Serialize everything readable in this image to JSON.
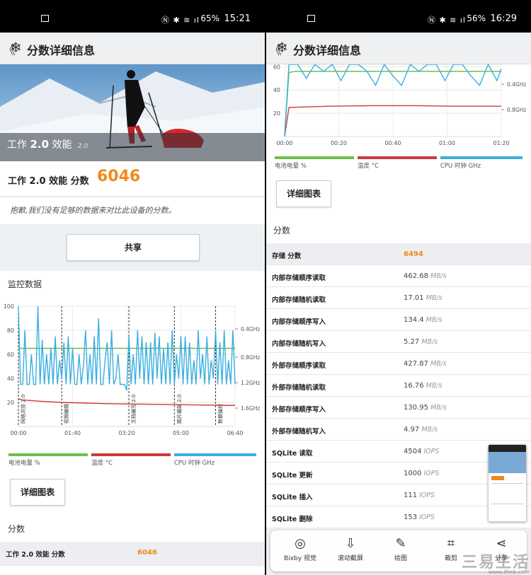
{
  "left": {
    "status": {
      "battery": "65%",
      "time": "15:21"
    },
    "appbar": {
      "back": "《",
      "title": "分数详细信息"
    },
    "hero": {
      "label_prefix": "工作",
      "label_version": "2.0",
      "label_suffix": "效能",
      "label_small": "2.0"
    },
    "score": {
      "label": "工作 2.0 效能 分数",
      "value": "6046"
    },
    "sorry_text": "抱歉,我们没有足够的数据来对比此设备的分数。",
    "share_button": "共享",
    "monitor_title": "监控数据",
    "legend": {
      "battery": "电池电量 %",
      "temp": "温度 °C",
      "cpu": "CPU 时钟 GHz"
    },
    "detail_button": "详细图表",
    "scores_title": "分数",
    "score_row": {
      "name": "工作 2.0 效能 分数",
      "value": "6046"
    },
    "chart_data": {
      "type": "line",
      "x_ticks": [
        "00:00",
        "01:40",
        "03:20",
        "05:00",
        "06:40"
      ],
      "y_ticks": [
        20,
        40,
        60,
        80,
        100
      ],
      "y2_ticks": [
        "0.4GHz",
        "0.8GHz",
        "1.2GHz",
        "1.6GHz"
      ],
      "ylim": [
        0,
        100
      ],
      "annotations": [
        "网络浏览 2.0",
        "视频编辑",
        "文档编写 2.0",
        "图片编辑 2.0",
        "数据操控"
      ],
      "series": [
        {
          "name": "电池电量 %",
          "color": "#6cc04a",
          "x": [
            0,
            0.1,
            0.2,
            0.4,
            0.6,
            0.8,
            1.0
          ],
          "y": [
            65,
            65,
            65,
            65,
            65,
            65,
            65
          ]
        },
        {
          "name": "温度 °C",
          "color": "#cc3b3b",
          "x": [
            0,
            0.02,
            0.1,
            0.2,
            0.4,
            0.6,
            0.8,
            1.0
          ],
          "y": [
            23,
            22,
            21,
            20,
            19,
            18.5,
            18,
            17.5
          ]
        },
        {
          "name": "CPU 时钟 GHz",
          "color": "#3aaee0",
          "x": [
            0,
            0.01,
            0.02,
            0.03,
            0.04,
            0.05,
            0.06,
            0.07,
            0.08,
            0.09,
            0.1,
            0.11,
            0.12,
            0.13,
            0.14,
            0.15,
            0.16,
            0.17,
            0.18,
            0.19,
            0.2,
            0.21,
            0.22,
            0.23,
            0.24,
            0.25,
            0.26,
            0.27,
            0.28,
            0.29,
            0.3,
            0.31,
            0.32,
            0.33,
            0.34,
            0.35,
            0.36,
            0.37,
            0.38,
            0.39,
            0.4,
            0.41,
            0.42,
            0.43,
            0.44,
            0.45,
            0.46,
            0.47,
            0.48,
            0.49,
            0.5,
            0.51,
            0.52,
            0.53,
            0.54,
            0.55,
            0.56,
            0.57,
            0.58,
            0.59,
            0.6,
            0.61,
            0.62,
            0.63,
            0.64,
            0.65,
            0.66,
            0.67,
            0.68,
            0.69,
            0.7,
            0.71,
            0.72,
            0.73,
            0.74,
            0.75,
            0.76,
            0.77,
            0.78,
            0.79,
            0.8,
            0.81,
            0.82,
            0.83,
            0.84,
            0.85,
            0.86,
            0.87,
            0.88,
            0.89,
            0.9,
            0.91,
            0.92,
            0.93,
            0.94,
            0.95,
            0.96,
            0.97,
            0.98,
            0.99,
            1.0
          ],
          "y": [
            100,
            35,
            35,
            80,
            35,
            35,
            60,
            35,
            35,
            100,
            35,
            72,
            35,
            60,
            35,
            65,
            35,
            75,
            35,
            55,
            40,
            70,
            35,
            75,
            35,
            65,
            35,
            35,
            60,
            35,
            50,
            80,
            35,
            60,
            35,
            75,
            35,
            90,
            35,
            35,
            55,
            70,
            35,
            80,
            35,
            40,
            60,
            35,
            35,
            35,
            30,
            75,
            35,
            60,
            35,
            80,
            40,
            75,
            35,
            70,
            35,
            70,
            35,
            78,
            40,
            75,
            35,
            65,
            35,
            70,
            35,
            80,
            35,
            60,
            40,
            75,
            35,
            75,
            35,
            70,
            35,
            55,
            35,
            80,
            40,
            60,
            35,
            75,
            35,
            55,
            40,
            80,
            35,
            70,
            35,
            80,
            35,
            55,
            35,
            80,
            35
          ]
        }
      ]
    }
  },
  "right": {
    "status": {
      "battery": "56%",
      "time": "16:29"
    },
    "appbar": {
      "back": "《",
      "title": "分数详细信息"
    },
    "legend": {
      "battery": "电池电量 %",
      "temp": "温度 °C",
      "cpu": "CPU 时钟 GHz"
    },
    "detail_button": "详细图表",
    "scores_title": "分数",
    "chart_data": {
      "type": "line",
      "x_ticks": [
        "00:00",
        "00:20",
        "00:40",
        "01:00",
        "01:20"
      ],
      "y_ticks": [
        20,
        40,
        60
      ],
      "y2_ticks": [
        "0.4GHz",
        "0.8GHz"
      ],
      "ylim": [
        0,
        62
      ],
      "series": [
        {
          "name": "电池电量 %",
          "color": "#6cc04a",
          "x": [
            0,
            0.02,
            0.05,
            1.0
          ],
          "y": [
            0,
            55,
            56,
            56
          ]
        },
        {
          "name": "温度 °C",
          "color": "#cc3b3b",
          "x": [
            0,
            0.02,
            0.2,
            0.4,
            0.6,
            0.8,
            1.0
          ],
          "y": [
            0,
            25,
            26,
            26.5,
            26.5,
            26,
            26
          ]
        },
        {
          "name": "CPU 时钟 GHz",
          "color": "#3aaee0",
          "x": [
            0,
            0.02,
            0.06,
            0.1,
            0.14,
            0.18,
            0.22,
            0.26,
            0.3,
            0.34,
            0.38,
            0.42,
            0.46,
            0.5,
            0.54,
            0.58,
            0.62,
            0.66,
            0.7,
            0.74,
            0.78,
            0.82,
            0.86,
            0.9,
            0.94,
            0.98,
            1.0
          ],
          "y": [
            0,
            62,
            62,
            50,
            62,
            56,
            62,
            48,
            62,
            62,
            56,
            44,
            62,
            52,
            44,
            62,
            56,
            62,
            62,
            48,
            62,
            62,
            52,
            44,
            62,
            48,
            58
          ]
        }
      ]
    },
    "rows": [
      {
        "name": "存储 分数",
        "value": "6494",
        "unit": "",
        "highlight": true
      },
      {
        "name": "内部存储顺序读取",
        "value": "462.68",
        "unit": "MB/s"
      },
      {
        "name": "内部存储随机读取",
        "value": "17.01",
        "unit": "MB/s"
      },
      {
        "name": "内部存储顺序写入",
        "value": "134.4",
        "unit": "MB/s"
      },
      {
        "name": "内部存储随机写入",
        "value": "5.27",
        "unit": "MB/s"
      },
      {
        "name": "外部存储顺序读取",
        "value": "427.87",
        "unit": "MB/s"
      },
      {
        "name": "外部存储随机读取",
        "value": "16.76",
        "unit": "MB/s"
      },
      {
        "name": "外部存储顺序写入",
        "value": "130.95",
        "unit": "MB/s"
      },
      {
        "name": "外部存储随机写入",
        "value": "4.97",
        "unit": "MB/s"
      },
      {
        "name": "SQLite 读取",
        "value": "4504",
        "unit": "IOPS"
      },
      {
        "name": "SQLite 更新",
        "value": "1000",
        "unit": "IOPS"
      },
      {
        "name": "SQLite 插入",
        "value": "111",
        "unit": "IOPS"
      },
      {
        "name": "SQLite 删除",
        "value": "153",
        "unit": "IOPS"
      }
    ],
    "toolbar": [
      {
        "label": "Bixby 视觉",
        "icon": "eye-icon"
      },
      {
        "label": "滚动截屏",
        "icon": "scroll-capture-icon"
      },
      {
        "label": "绘图",
        "icon": "pen-icon"
      },
      {
        "label": "裁剪",
        "icon": "crop-icon"
      },
      {
        "label": "分享",
        "icon": "share-icon"
      }
    ],
    "watermark": "三易生活",
    "watermark_url": "www.ifmb.com"
  }
}
